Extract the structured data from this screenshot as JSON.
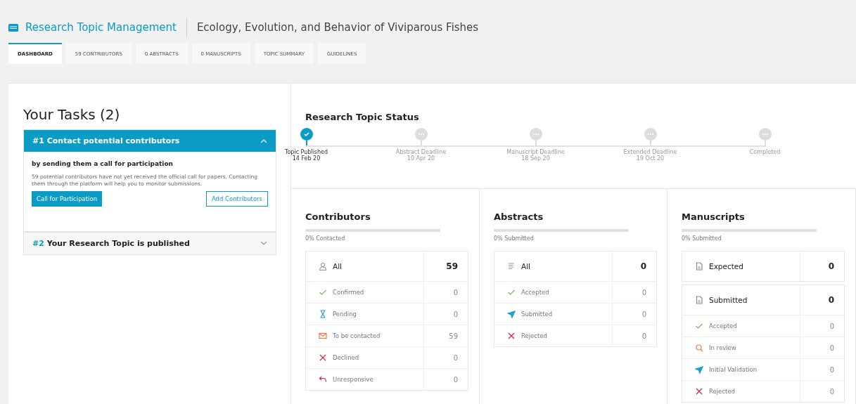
{
  "header": {
    "app_title": "Research Topic Management",
    "topic_title": "Ecology, Evolution, and Behavior of Viviparous Fishes"
  },
  "tabs": [
    {
      "label": "DASHBOARD",
      "selected": true
    },
    {
      "label": "59 CONTRIBUTORS",
      "selected": false
    },
    {
      "label": "0 ABSTRACTS",
      "selected": false
    },
    {
      "label": "0 MANUSCRIPTS",
      "selected": false
    },
    {
      "label": "TOPIC SUMMARY",
      "selected": false
    },
    {
      "label": "GUIDELINES",
      "selected": false
    }
  ],
  "tasks": {
    "title": "Your Tasks (2)",
    "items": [
      {
        "number": "#1",
        "title": "Contact potential contributors",
        "expanded": true,
        "subtitle": "by sending them a call for participation",
        "text": "59 potential contributors have not yet received the official call for papers. Contacting them through the platform will help you to monitor submissions.",
        "primary_button": "Call for Participation",
        "secondary_button": "Add Contributors"
      },
      {
        "number": "#2",
        "title": "Your Research Topic is published",
        "expanded": false
      }
    ]
  },
  "status": {
    "title": "Research Topic Status",
    "milestones": [
      {
        "label": "Topic Published",
        "date": "14 Feb 20",
        "done": true
      },
      {
        "label": "Abstract Deadline",
        "date": "10 Apr 20",
        "done": false
      },
      {
        "label": "Manuscript Deadline",
        "date": "18 Sep 20",
        "done": false
      },
      {
        "label": "Extended Deadline",
        "date": "19 Oct 20",
        "done": false
      },
      {
        "label": "Completed",
        "done": false
      }
    ]
  },
  "panels": [
    {
      "title": "Contributors",
      "level": 0,
      "progress_label": "0% Contacted",
      "groups": [
        [
          {
            "kind": "person",
            "label": "All",
            "count": "59"
          },
          {
            "kind": "confirmed",
            "label": "Confirmed",
            "count": "0"
          },
          {
            "kind": "pending",
            "label": "Pending",
            "count": "0"
          },
          {
            "kind": "mail",
            "label": "To be contacted",
            "count": "59"
          },
          {
            "kind": "rejected",
            "label": "Declined",
            "count": "0"
          },
          {
            "kind": "reply",
            "label": "Unresponsive",
            "count": "0"
          }
        ]
      ]
    },
    {
      "title": "Abstracts",
      "level": 0,
      "progress_label": "0% Submitted",
      "groups": [
        [
          {
            "kind": "lines",
            "label": "All",
            "count": "0"
          },
          {
            "kind": "confirmed",
            "label": "Accepted",
            "count": "0"
          },
          {
            "kind": "sent",
            "label": "Submitted",
            "count": "0"
          },
          {
            "kind": "rejected",
            "label": "Rejected",
            "count": "0"
          }
        ]
      ]
    },
    {
      "title": "Manuscripts",
      "level": 0,
      "progress_label": "0% Submitted",
      "groups": [
        [
          {
            "kind": "document",
            "label": "Expected",
            "count": "0"
          }
        ],
        [
          {
            "kind": "document",
            "label": "Submitted",
            "count": "0"
          },
          {
            "kind": "confirmed",
            "label": "Accepted",
            "count": "0"
          },
          {
            "kind": "review",
            "label": "In review",
            "count": "0"
          },
          {
            "kind": "sent",
            "label": "Initial Validation",
            "count": "0"
          },
          {
            "kind": "rejected",
            "label": "Rejected",
            "count": "0"
          }
        ]
      ]
    }
  ]
}
